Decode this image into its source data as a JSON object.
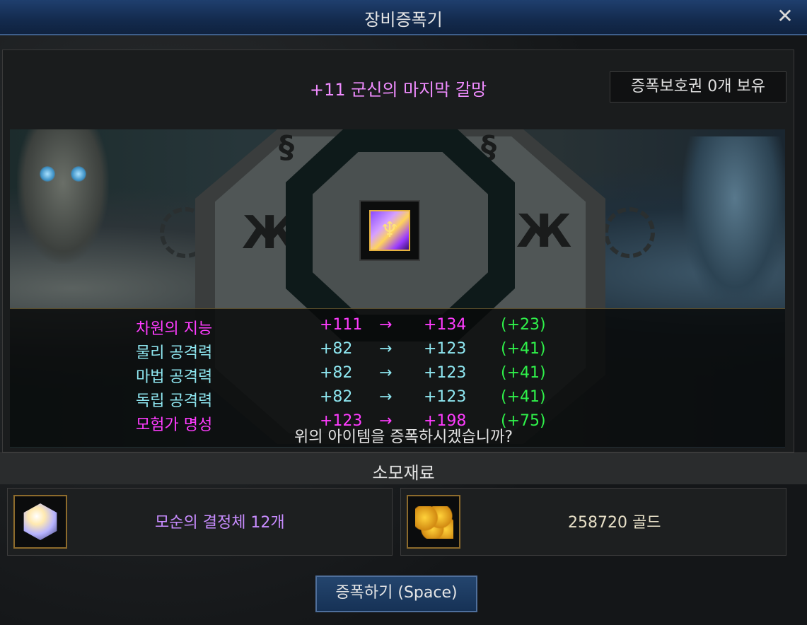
{
  "window": {
    "title": "장비증폭기",
    "close_symbol": "✕"
  },
  "item": {
    "name": "+11 군신의 마지막 갈망",
    "icon": "golden-relic-icon"
  },
  "protection": {
    "text": "증폭보호권 0개 보유"
  },
  "stats": [
    {
      "name": "차원의 지능",
      "before": "+111",
      "arrow": "→",
      "after": "+134",
      "diff": "(+23)",
      "color": "#ff3cff"
    },
    {
      "name": "물리 공격력",
      "before": "+82",
      "arrow": "→",
      "after": "+123",
      "diff": "(+41)",
      "color": "#8ee6f0"
    },
    {
      "name": "마법 공격력",
      "before": "+82",
      "arrow": "→",
      "after": "+123",
      "diff": "(+41)",
      "color": "#8ee6f0"
    },
    {
      "name": "독립 공격력",
      "before": "+82",
      "arrow": "→",
      "after": "+123",
      "diff": "(+41)",
      "color": "#8ee6f0"
    },
    {
      "name": "모험가 명성",
      "before": "+123",
      "arrow": "→",
      "after": "+198",
      "diff": "(+75)",
      "color": "#ff3cff"
    }
  ],
  "confirm": {
    "text": "위의 아이템을 증폭하시겠습니까?"
  },
  "materials": {
    "header": "소모재료",
    "items": [
      {
        "label": "모순의 결정체 12개",
        "icon": "crystal-icon",
        "color": "#c88cff"
      },
      {
        "label": "258720 골드",
        "icon": "gold-coins-icon",
        "color": "#e8e0c8"
      }
    ]
  },
  "action": {
    "label": "증폭하기 (Space)"
  },
  "colors": {
    "diff_green": "#2ff24a",
    "title_bar": "#1f3f6e",
    "item_name": "#f08cff"
  }
}
